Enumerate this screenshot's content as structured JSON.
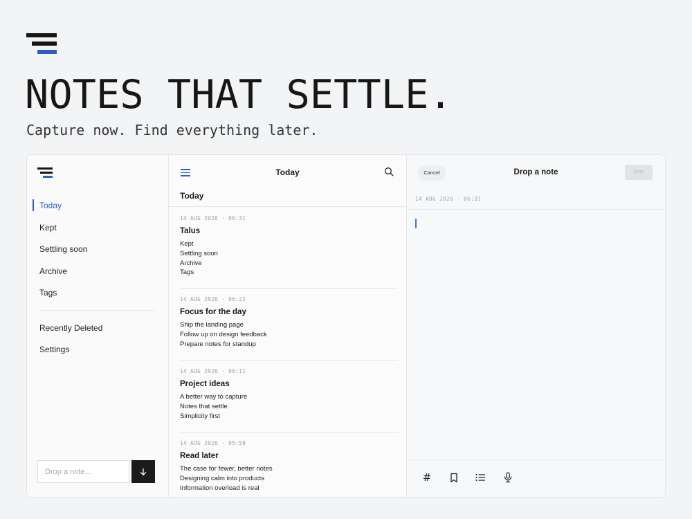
{
  "brand": {
    "accent": "#2f5fc4",
    "dark": "#161616"
  },
  "hero": {
    "logo": "stacked-bars-logo",
    "headline": "NOTES THAT SETTLE.",
    "subhead": "Capture now. Find everything later."
  },
  "sidebar": {
    "items": [
      {
        "label": "Today",
        "active": true
      },
      {
        "label": "Kept"
      },
      {
        "label": "Settling soon"
      },
      {
        "label": "Archive"
      },
      {
        "label": "Tags"
      }
    ],
    "secondary": [
      {
        "label": "Recently Deleted"
      },
      {
        "label": "Settings"
      }
    ],
    "input_placeholder": "Drop a note...",
    "submit_icon": "arrow-down-icon"
  },
  "list": {
    "title": "Today",
    "section": "Today",
    "notes": [
      {
        "time": "14 AUG 2026 · 06:31",
        "title": "Talus",
        "lines": [
          "Kept",
          "Settling soon",
          "Archive",
          "Tags"
        ]
      },
      {
        "time": "14 AUG 2026 · 06:22",
        "title": "Focus for the day",
        "lines": [
          "Ship the landing page",
          "Follow up on design feedback",
          "Prepare notes for standup"
        ]
      },
      {
        "time": "14 AUG 2026 · 06:11",
        "title": "Project ideas",
        "lines": [
          "A better way to capture",
          "Notes that settle",
          "Simplicity first"
        ]
      },
      {
        "time": "14 AUG 2026 · 05:58",
        "title": "Read later",
        "lines": [
          "The case for fewer, better notes",
          "Designing calm into products",
          "Information overload is real"
        ]
      }
    ]
  },
  "editor": {
    "cancel": "Cancel",
    "title": "Drop a note",
    "drop": "Drop",
    "timestamp": "14 AUG 2026 · 06:31",
    "tools": [
      "hash-icon",
      "bookmark-icon",
      "list-icon",
      "microphone-icon"
    ]
  }
}
